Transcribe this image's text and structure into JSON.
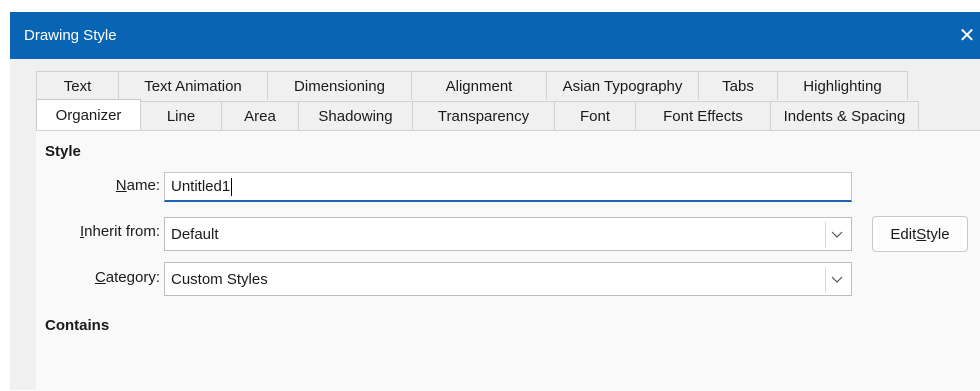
{
  "window": {
    "title": "Drawing Style",
    "close_glyph": "✕"
  },
  "tabs_row1": [
    {
      "label": "Text"
    },
    {
      "label": "Text Animation"
    },
    {
      "label": "Dimensioning"
    },
    {
      "label": "Alignment"
    },
    {
      "label": "Asian Typography"
    },
    {
      "label": "Tabs"
    },
    {
      "label": "Highlighting"
    }
  ],
  "tabs_row2": [
    {
      "label": "Organizer"
    },
    {
      "label": "Line"
    },
    {
      "label": "Area"
    },
    {
      "label": "Shadowing"
    },
    {
      "label": "Transparency"
    },
    {
      "label": "Font"
    },
    {
      "label": "Font Effects"
    },
    {
      "label": "Indents & Spacing"
    }
  ],
  "active_tab": "Organizer",
  "style_section": {
    "heading": "Style",
    "name": {
      "label_u": "N",
      "label_rest": "ame:",
      "value": "Untitled1"
    },
    "inherit": {
      "label_u": "I",
      "label_rest": "nherit from:",
      "value": "Default"
    },
    "edit_style": {
      "label_pre": "Edit ",
      "label_u": "S",
      "label_post": "tyle"
    },
    "category": {
      "label_u": "C",
      "label_rest": "ategory:",
      "value": "Custom Styles"
    }
  },
  "contains_section": {
    "heading": "Contains"
  }
}
